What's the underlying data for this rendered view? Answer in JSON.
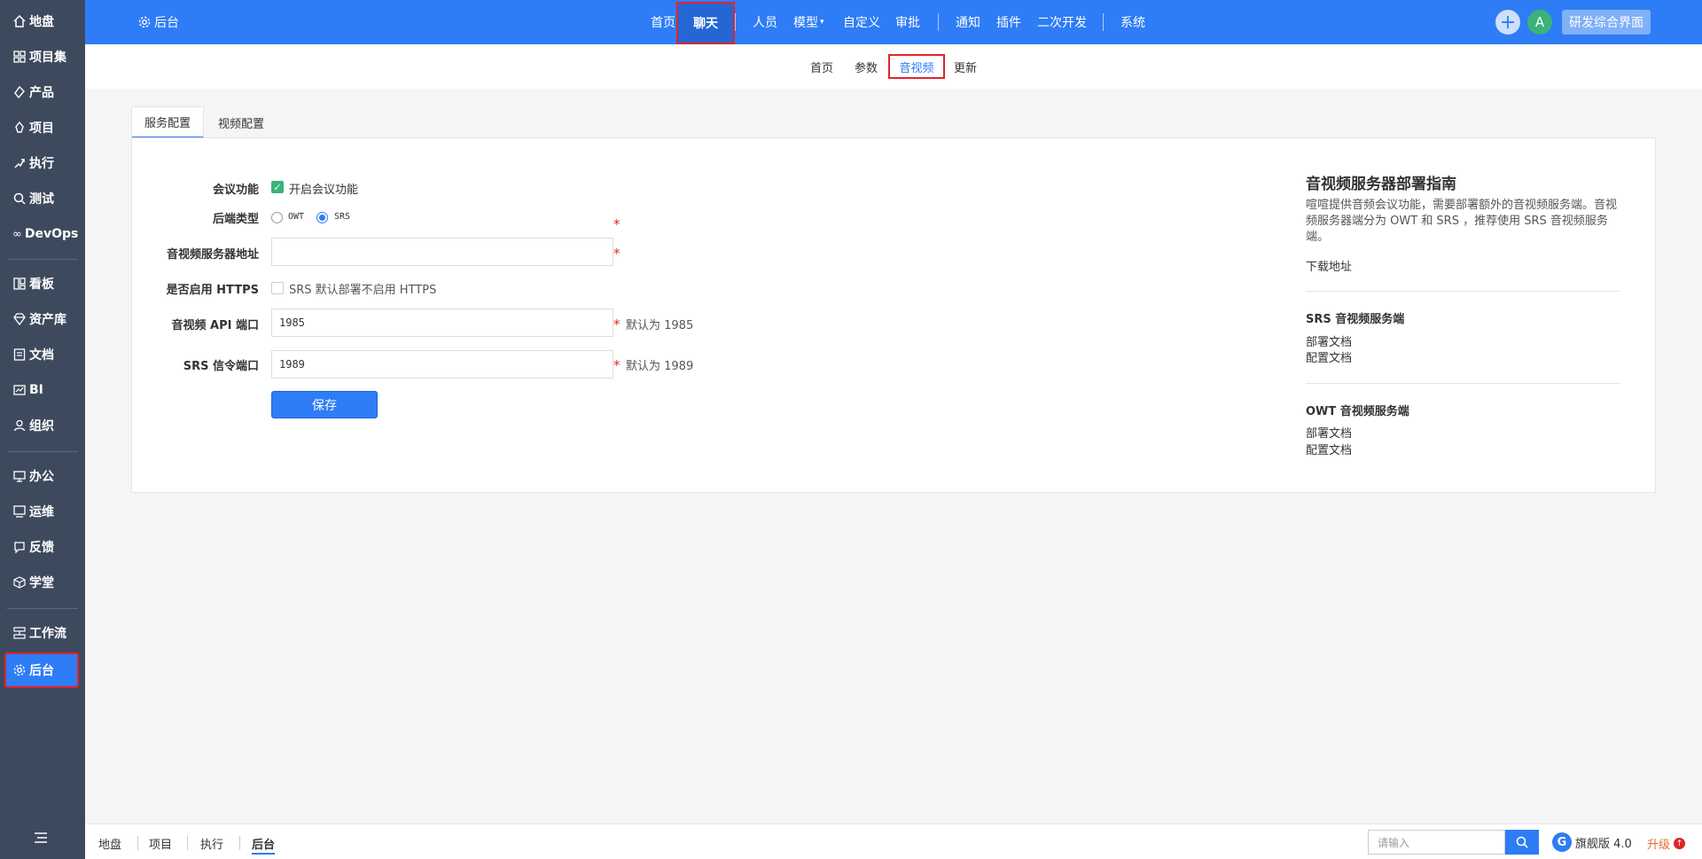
{
  "sidebar": {
    "items": [
      {
        "label": "地盘",
        "icon": "home-icon"
      },
      {
        "label": "项目集",
        "icon": "grid-icon"
      },
      {
        "label": "产品",
        "icon": "product-icon"
      },
      {
        "label": "项目",
        "icon": "project-icon"
      },
      {
        "label": "执行",
        "icon": "run-icon"
      },
      {
        "label": "测试",
        "icon": "test-icon"
      },
      {
        "label": "DevOps",
        "icon": "infinity-icon"
      },
      {
        "label": "看板",
        "icon": "board-icon"
      },
      {
        "label": "资产库",
        "icon": "diamond-icon"
      },
      {
        "label": "文档",
        "icon": "doc-icon"
      },
      {
        "label": "BI",
        "icon": "chart-icon"
      },
      {
        "label": "组织",
        "icon": "people-icon"
      },
      {
        "label": "办公",
        "icon": "office-icon"
      },
      {
        "label": "运维",
        "icon": "ops-icon"
      },
      {
        "label": "反馈",
        "icon": "feedback-icon"
      },
      {
        "label": "学堂",
        "icon": "cube-icon"
      },
      {
        "label": "工作流",
        "icon": "workflow-icon"
      },
      {
        "label": "后台",
        "icon": "gear-icon"
      }
    ],
    "active": "后台"
  },
  "topbar": {
    "home_label": "后台",
    "nav": [
      "首页",
      "聊天",
      "人员",
      "模型",
      "自定义",
      "审批",
      "通知",
      "插件",
      "二次开发",
      "系统"
    ],
    "active": "聊天",
    "avatar_letter": "A",
    "right_button": "研发综合界面"
  },
  "subnav": {
    "items": [
      "首页",
      "参数",
      "音视频",
      "更新"
    ],
    "active": "音视频"
  },
  "tabs": {
    "items": [
      "服务配置",
      "视频配置"
    ],
    "active": "服务配置"
  },
  "form": {
    "meeting_label": "会议功能",
    "meeting_checkbox_text": "开启会议功能",
    "backend_label": "后端类型",
    "backend_options": [
      "OWT",
      "SRS"
    ],
    "backend_selected": "SRS",
    "server_label": "音视频服务器地址",
    "server_value": "",
    "https_label": "是否启用 HTTPS",
    "https_text": "SRS 默认部署不启用 HTTPS",
    "api_port_label": "音视频 API 端口",
    "api_port_value": "1985",
    "api_port_hint": "默认为 1985",
    "srs_port_label": "SRS 信令端口",
    "srs_port_value": "1989",
    "srs_port_hint": "默认为 1989",
    "save_label": "保存"
  },
  "guide": {
    "title": "音视频服务器部署指南",
    "description": "喧喧提供音频会议功能，需要部署额外的音视频服务端。音视频服务器端分为 OWT 和 SRS ，推荐使用 SRS 音视频服务端。",
    "download_link": "下载地址",
    "srs_heading": "SRS 音视频服务端",
    "owt_heading": "OWT 音视频服务端",
    "deploy_doc": "部署文档",
    "config_doc": "配置文档"
  },
  "bottombar": {
    "breadcrumb": [
      "地盘",
      "项目",
      "执行",
      "后台"
    ],
    "active": "后台",
    "search_placeholder": "请输入",
    "edition": "旗舰版 4.0",
    "upgrade": "升级"
  },
  "colors": {
    "primary": "#2e7cf6",
    "sidebar": "#3d4a5e",
    "highlight": "#e0242b"
  }
}
